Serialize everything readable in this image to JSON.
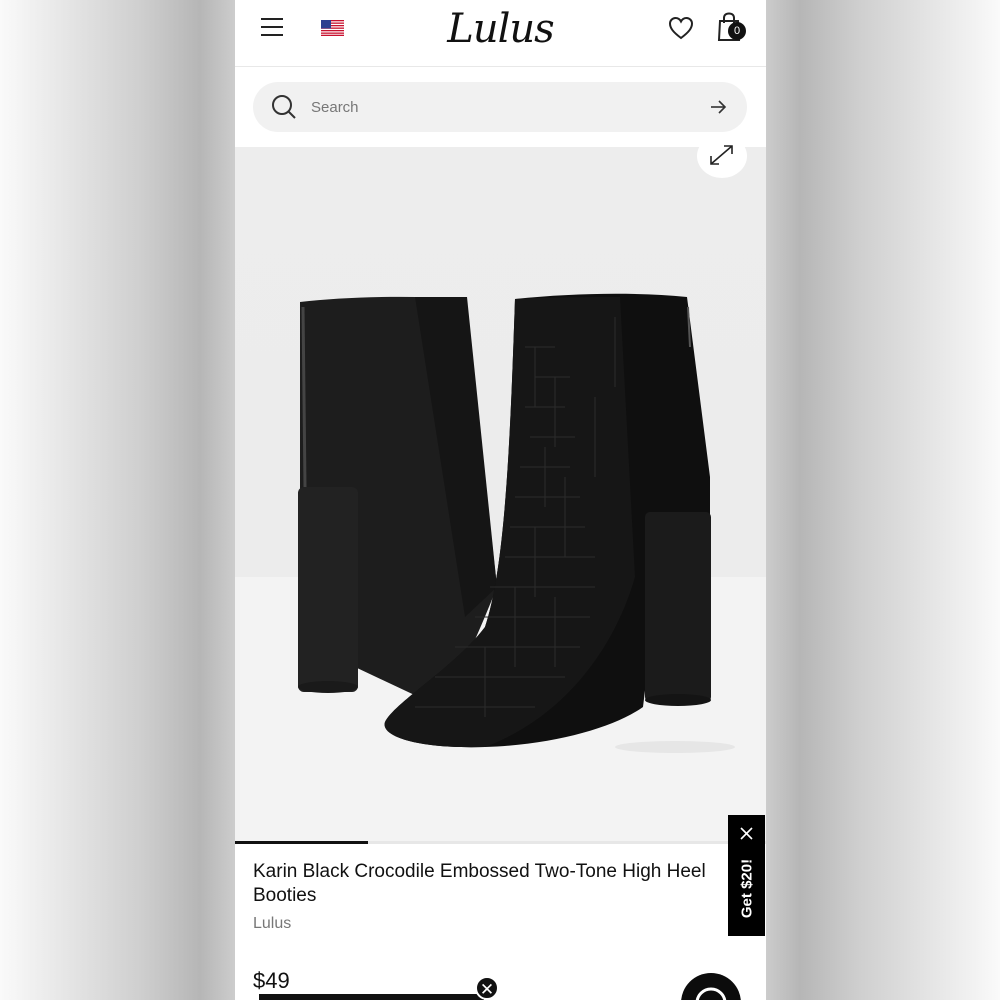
{
  "header": {
    "menu_icon": "hamburger-menu-icon",
    "flag_icon": "us-flag-icon",
    "logo_text": "Lulus",
    "wishlist_icon": "heart-icon",
    "bag_icon": "shopping-bag-icon",
    "bag_count": "0"
  },
  "search": {
    "placeholder": "Search",
    "search_icon": "search-icon",
    "submit_icon": "arrow-right-icon"
  },
  "gallery": {
    "expand_icon": "expand-icon",
    "image_alt": "Karin Black Crocodile Embossed Two-Tone High Heel Booties",
    "progress": 0.25
  },
  "product": {
    "title_line1": "Karin Black Crocodile Embossed Two-Tone High Heel",
    "title_line2": "Booties",
    "brand": "Lulus",
    "price": "$49"
  },
  "promo": {
    "close_icon": "close-icon",
    "chat_icon": "chat-icon"
  },
  "side_tab": {
    "label": "Get $20!",
    "close_icon": "close-icon"
  },
  "colors": {
    "accent": "#111111",
    "search_bg": "#f1f1f1",
    "brand_text": "#777777"
  }
}
